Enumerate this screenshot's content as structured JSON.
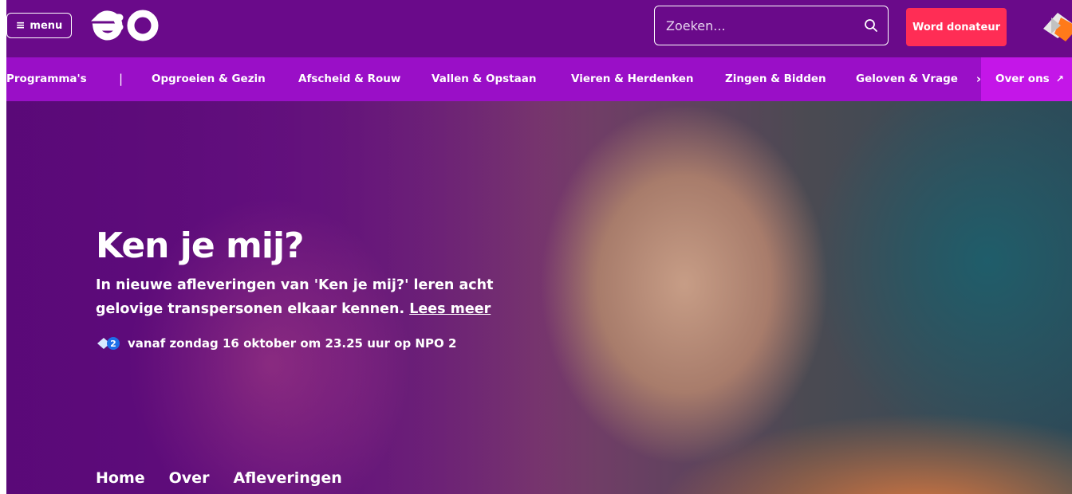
{
  "header": {
    "menu_label": "menu",
    "search_placeholder": "Zoeken...",
    "donate_label": "Word donateur",
    "brand_color": "#6a0a8a",
    "accent_color": "#ff2d55"
  },
  "nav": {
    "items": [
      "Programma's",
      "Opgroeien & Gezin",
      "Afscheid & Rouw",
      "Vallen & Opstaan",
      "Vieren & Herdenken",
      "Zingen & Bidden",
      "Geloven & Vrage"
    ],
    "separator": "|",
    "over_label": "Over ons",
    "color": "#9a0fc7"
  },
  "hero": {
    "title": "Ken je mij?",
    "desc_line1": "In nieuwe afleveringen van 'Ken je mij?' leren acht",
    "desc_line2": "gelovige transpersonen elkaar kennen.",
    "link_label": "Lees meer",
    "air_text": "vanaf zondag 16 oktober om 23.25 uur op NPO 2"
  },
  "subnav": {
    "items": [
      "Home",
      "Over",
      "Afleveringen"
    ]
  },
  "icons": {
    "menu": "hamburger-icon",
    "search": "search-icon",
    "chevron": "chevron-right-icon",
    "external": "external-link-icon",
    "channel": "npo2-icon",
    "badge": "npo-start-icon"
  }
}
